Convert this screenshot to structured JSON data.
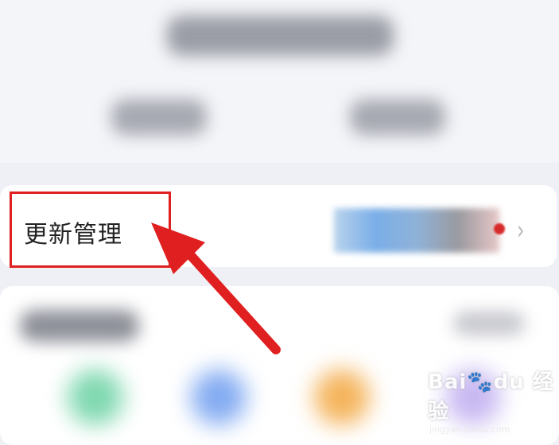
{
  "update_row": {
    "label": "更新管理"
  },
  "watermark": {
    "brand": "Bai🐾du 经验",
    "url": "jingyan.baidu.com"
  },
  "colors": {
    "highlight_box": "#e02020",
    "arrow": "#e02020"
  }
}
